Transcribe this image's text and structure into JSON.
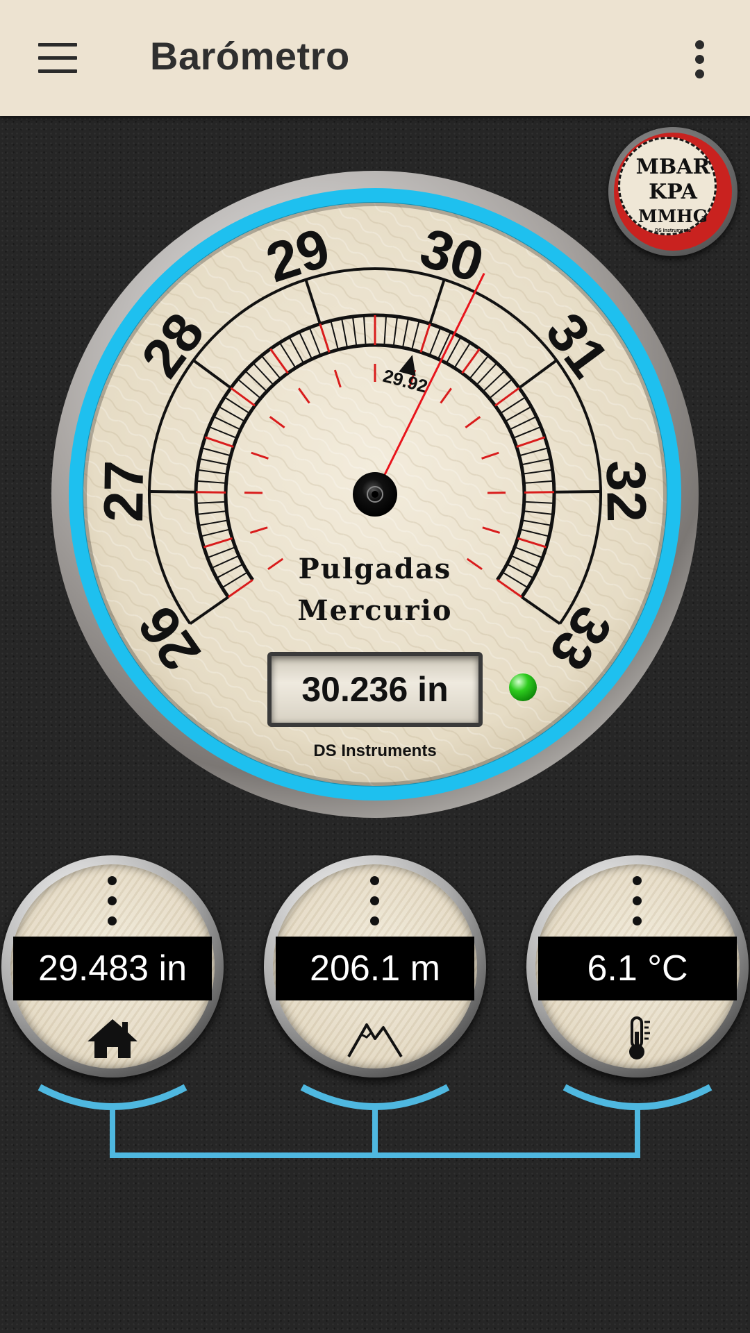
{
  "app_bar": {
    "title": "Barómetro",
    "menu_icon": "hamburger-menu-icon",
    "overflow_icon": "more-vert-icon"
  },
  "unit_selector": {
    "lines": [
      "MBAR",
      "KPA",
      "MMHG"
    ],
    "brand": "DS Instruments"
  },
  "gauge": {
    "unit_line1": "Pulgadas",
    "unit_line2": "Mercurio",
    "scale_labels": [
      "26",
      "27",
      "28",
      "29",
      "30",
      "31",
      "32",
      "33"
    ],
    "scale_min": 26,
    "scale_max": 33,
    "reference_value": 29.92,
    "reference_label": "29.92",
    "needle_value": 30.236,
    "reading": "30.236 in",
    "status_led_color": "#2ecc1f",
    "brand": "DS Instruments",
    "ring_color": "#1ec0ef"
  },
  "mini_gauges": [
    {
      "value": "29.483 in",
      "icon": "home-icon"
    },
    {
      "value": "206.1 m",
      "icon": "mountain-icon"
    },
    {
      "value": "6.1 °C",
      "icon": "thermometer-icon"
    }
  ],
  "connector_color": "#4fb8e0"
}
